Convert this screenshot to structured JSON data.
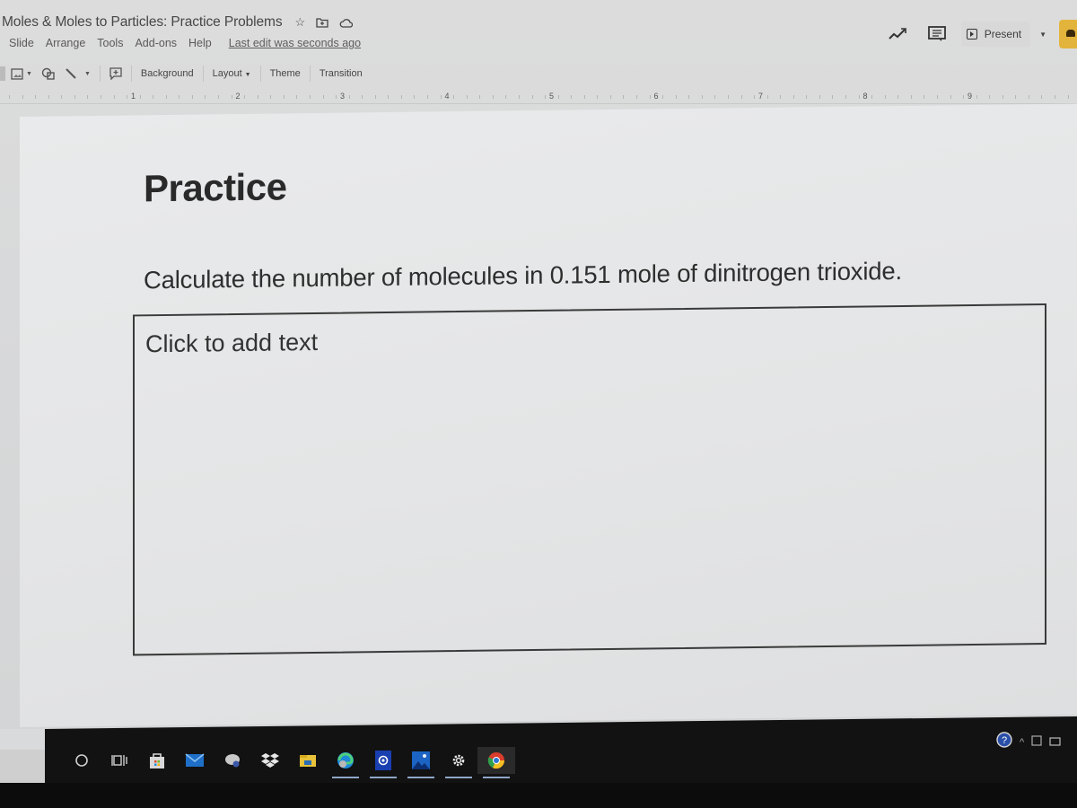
{
  "document": {
    "title": "Moles & Moles to Particles: Practice Problems",
    "title_icons": [
      "star-icon",
      "move-to-folder-icon",
      "cloud-saved-icon"
    ]
  },
  "menu": {
    "items": [
      "Slide",
      "Arrange",
      "Tools",
      "Add-ons",
      "Help"
    ],
    "last_edit": "Last edit was seconds ago"
  },
  "header_right": {
    "present_label": "Present",
    "icons": [
      "activity-dashboard-icon",
      "comments-icon",
      "present-play-icon",
      "present-dropdown-icon",
      "share-button"
    ]
  },
  "toolbar": {
    "icons": [
      "image-icon",
      "shape-icon",
      "line-icon",
      "comment-add-icon"
    ],
    "background_label": "Background",
    "layout_label": "Layout",
    "theme_label": "Theme",
    "transition_label": "Transition"
  },
  "ruler": {
    "numbers": [
      "1",
      "2",
      "3",
      "4",
      "5",
      "6",
      "7",
      "8",
      "9"
    ]
  },
  "slide": {
    "title": "Practice",
    "question": "Calculate the number of molecules in 0.151 mole of dinitrogen trioxide.",
    "answer_placeholder": "Click to add text"
  },
  "taskbar": {
    "apps": [
      {
        "name": "search",
        "icon": "cortana-circle-icon",
        "active": false
      },
      {
        "name": "task-view",
        "icon": "task-view-icon",
        "active": false
      },
      {
        "name": "store",
        "icon": "microsoft-store-icon",
        "active": false
      },
      {
        "name": "mail",
        "icon": "mail-icon",
        "active": false
      },
      {
        "name": "app",
        "icon": "app-icon",
        "active": false
      },
      {
        "name": "dropbox",
        "icon": "dropbox-icon",
        "active": false
      },
      {
        "name": "file-explorer",
        "icon": "file-explorer-icon",
        "active": false
      },
      {
        "name": "edge",
        "icon": "edge-icon",
        "active": true
      },
      {
        "name": "camera",
        "icon": "camera-icon",
        "active": true
      },
      {
        "name": "photos",
        "icon": "photos-icon",
        "active": true
      },
      {
        "name": "settings",
        "icon": "settings-gear-icon",
        "active": true
      },
      {
        "name": "chrome",
        "icon": "chrome-icon",
        "active": true
      }
    ],
    "tray_icons": [
      "help-icon",
      "show-hidden-icons-chevron",
      "tray-app-icon",
      "battery-icon"
    ]
  }
}
